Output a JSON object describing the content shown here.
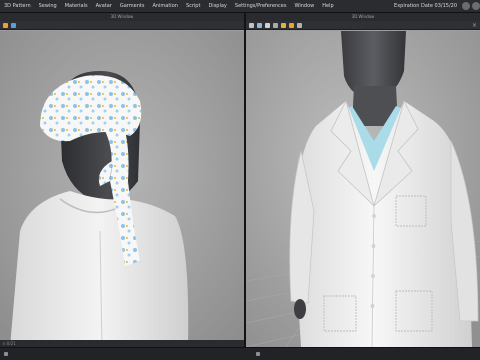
{
  "menu": {
    "items": [
      "3D Pattern",
      "Sewing",
      "Materials",
      "Avatar",
      "Garments",
      "Animation",
      "Script",
      "Display",
      "Settings/Preferences",
      "Window",
      "Help"
    ],
    "expiration": "Expiration Date 03/15/20"
  },
  "left_pane": {
    "title": "3D Window",
    "status": "n 0/21"
  },
  "right_pane": {
    "title": "3D Window",
    "close": "×"
  },
  "colors": {
    "accent": "#f0a030",
    "background": "#9e9e9e",
    "coat": "#f2f2f2",
    "scrub": "#a9dce8"
  }
}
